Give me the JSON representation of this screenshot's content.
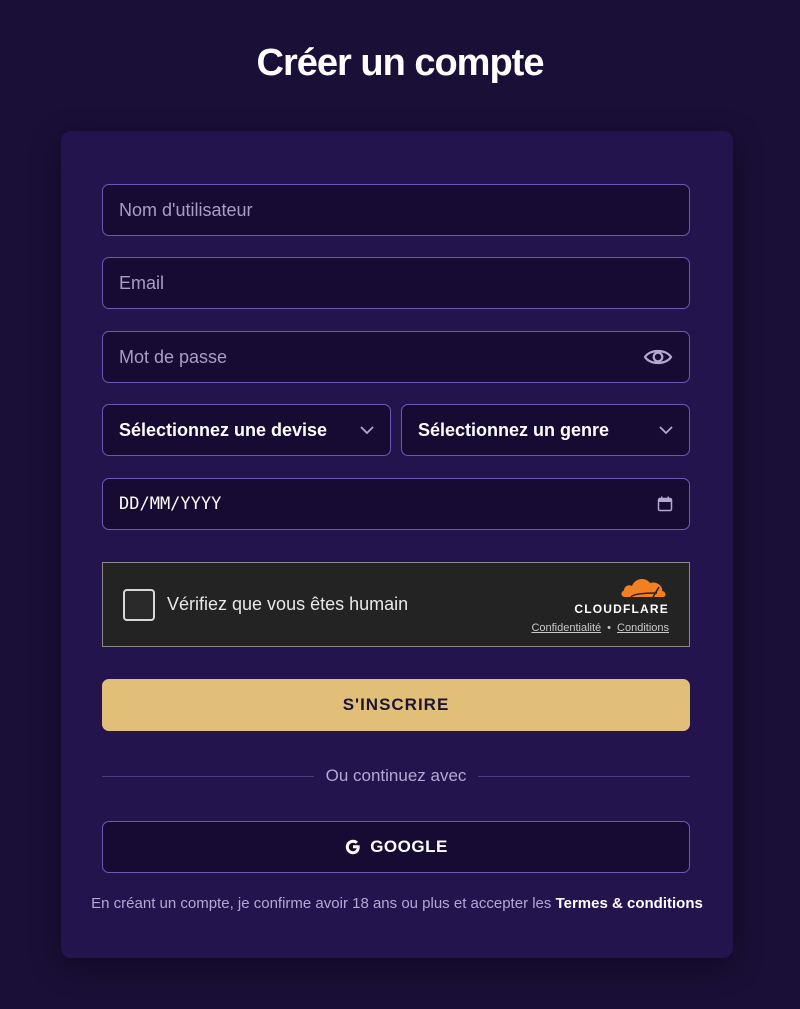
{
  "page": {
    "title": "Créer un compte"
  },
  "form": {
    "username": {
      "placeholder": "Nom d'utilisateur",
      "value": ""
    },
    "email": {
      "placeholder": "Email",
      "value": ""
    },
    "password": {
      "placeholder": "Mot de passe",
      "value": ""
    },
    "currency_select": {
      "selected": "Sélectionnez une devise"
    },
    "gender_select": {
      "selected": "Sélectionnez un genre"
    },
    "birthdate": {
      "value": "DD/MM/YYYY"
    },
    "submit_label": "S'INSCRIRE"
  },
  "captcha": {
    "label": "Vérifiez que vous êtes humain",
    "brand": "CLOUDFLARE",
    "privacy_link": "Confidentialité",
    "separator": "•",
    "terms_link": "Conditions"
  },
  "social": {
    "divider_text": "Ou continuez avec",
    "google_label": "GOOGLE"
  },
  "footer": {
    "consent_text": "En créant un compte, je confirme avoir 18 ans ou plus et accepter les ",
    "terms_link": "Termes & conditions"
  },
  "colors": {
    "background": "#1a0f36",
    "card": "#23144d",
    "field_bg": "#170b33",
    "field_border": "#6d58b4",
    "accent": "#e2bf78",
    "cloudflare_orange": "#f38020"
  },
  "icons": {
    "password_toggle": "eye-icon",
    "select_arrow": "chevron-down-icon",
    "date_picker": "calendar-icon",
    "google": "google-g-icon",
    "cloudflare": "cloudflare-cloud-icon"
  }
}
